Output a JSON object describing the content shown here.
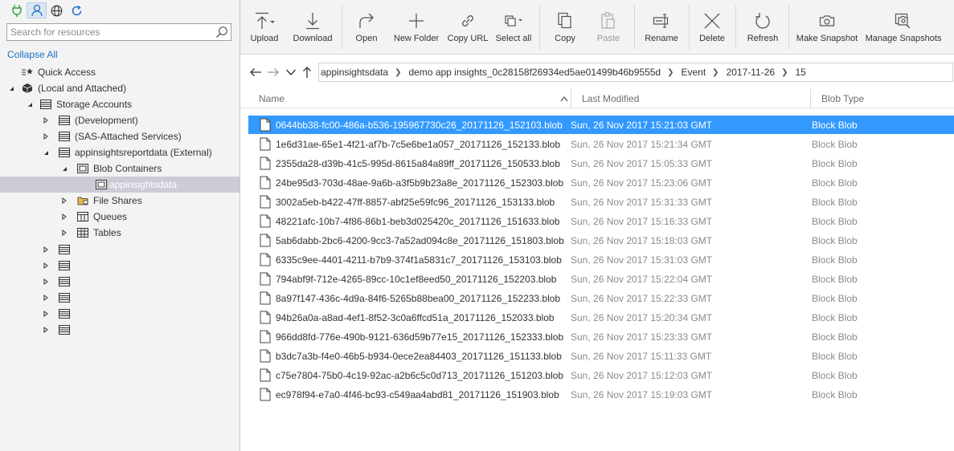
{
  "left_pane": {
    "search_placeholder": "Search for resources",
    "collapse_all": "Collapse All",
    "tree": {
      "quick_access": "Quick Access",
      "local_attached": "(Local and Attached)",
      "storage_accounts": "Storage Accounts",
      "development": "(Development)",
      "sas_attached": "(SAS-Attached Services)",
      "appinsights_account": "appinsightsreportdata (External)",
      "blob_containers": "Blob Containers",
      "selected_container": "appinsightsdata",
      "file_shares": "File Shares",
      "queues": "Queues",
      "tables": "Tables"
    }
  },
  "toolbar": {
    "upload": "Upload",
    "download": "Download",
    "open": "Open",
    "new_folder": "New Folder",
    "copy_url": "Copy URL",
    "select_all": "Select all",
    "copy": "Copy",
    "paste": "Paste",
    "rename": "Rename",
    "delete": "Delete",
    "refresh": "Refresh",
    "make_snapshot": "Make Snapshot",
    "manage_snapshots": "Manage Snapshots"
  },
  "breadcrumb": [
    "appinsightsdata",
    "demo app insights_0c28158f26934ed5ae01499b46b9555d",
    "Event",
    "2017-11-26",
    "15"
  ],
  "columns": {
    "name": "Name",
    "last_modified": "Last Modified",
    "blob_type": "Blob Type"
  },
  "blobs": [
    {
      "name": "0644bb38-fc00-486a-b536-195967730c26_20171126_152103.blob",
      "modified": "Sun, 26 Nov 2017 15:21:03 GMT",
      "type": "Block Blob"
    },
    {
      "name": "1e6d31ae-65e1-4f21-af7b-7c5e6be1a057_20171126_152133.blob",
      "modified": "Sun, 26 Nov 2017 15:21:34 GMT",
      "type": "Block Blob"
    },
    {
      "name": "2355da28-d39b-41c5-995d-8615a84a89ff_20171126_150533.blob",
      "modified": "Sun, 26 Nov 2017 15:05:33 GMT",
      "type": "Block Blob"
    },
    {
      "name": "24be95d3-703d-48ae-9a6b-a3f5b9b23a8e_20171126_152303.blob",
      "modified": "Sun, 26 Nov 2017 15:23:06 GMT",
      "type": "Block Blob"
    },
    {
      "name": "3002a5eb-b422-47ff-8857-abf25e59fc96_20171126_153133.blob",
      "modified": "Sun, 26 Nov 2017 15:31:33 GMT",
      "type": "Block Blob"
    },
    {
      "name": "48221afc-10b7-4f86-86b1-beb3d025420c_20171126_151633.blob",
      "modified": "Sun, 26 Nov 2017 15:16:33 GMT",
      "type": "Block Blob"
    },
    {
      "name": "5ab6dabb-2bc6-4200-9cc3-7a52ad094c8e_20171126_151803.blob",
      "modified": "Sun, 26 Nov 2017 15:18:03 GMT",
      "type": "Block Blob"
    },
    {
      "name": "6335c9ee-4401-4211-b7b9-374f1a5831c7_20171126_153103.blob",
      "modified": "Sun, 26 Nov 2017 15:31:03 GMT",
      "type": "Block Blob"
    },
    {
      "name": "794abf9f-712e-4265-89cc-10c1ef8eed50_20171126_152203.blob",
      "modified": "Sun, 26 Nov 2017 15:22:04 GMT",
      "type": "Block Blob"
    },
    {
      "name": "8a97f147-436c-4d9a-84f6-5265b88bea00_20171126_152233.blob",
      "modified": "Sun, 26 Nov 2017 15:22:33 GMT",
      "type": "Block Blob"
    },
    {
      "name": "94b26a0a-a8ad-4ef1-8f52-3c0a6ffcd51a_20171126_152033.blob",
      "modified": "Sun, 26 Nov 2017 15:20:34 GMT",
      "type": "Block Blob"
    },
    {
      "name": "966dd8fd-776e-490b-9121-636d59b77e15_20171126_152333.blob",
      "modified": "Sun, 26 Nov 2017 15:23:33 GMT",
      "type": "Block Blob"
    },
    {
      "name": "b3dc7a3b-f4e0-46b5-b934-0ece2ea84403_20171126_151133.blob",
      "modified": "Sun, 26 Nov 2017 15:11:33 GMT",
      "type": "Block Blob"
    },
    {
      "name": "c75e7804-75b0-4c19-92ac-a2b6c5c0d713_20171126_151203.blob",
      "modified": "Sun, 26 Nov 2017 15:12:03 GMT",
      "type": "Block Blob"
    },
    {
      "name": "ec978f94-e7a0-4f46-bc93-c549aa4abd81_20171126_151903.blob",
      "modified": "Sun, 26 Nov 2017 15:19:03 GMT",
      "type": "Block Blob"
    }
  ],
  "colors": {
    "selection": "#3399ff",
    "tree_selection": "#ccccd6",
    "link": "#1e73c8",
    "pane_bg": "#f3f3f3"
  }
}
